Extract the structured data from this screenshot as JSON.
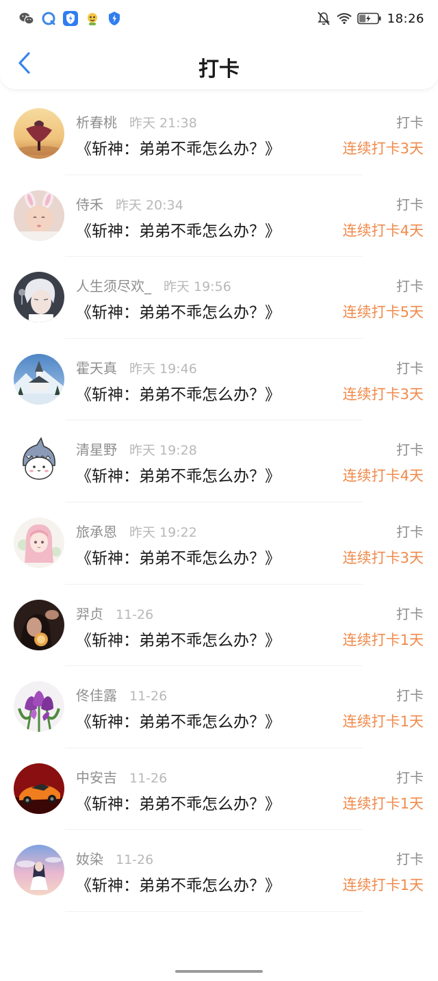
{
  "status_bar": {
    "time": "18:26",
    "left_icons": [
      "wechat-icon",
      "qq-icon",
      "security-shield-icon",
      "mascot-icon",
      "shield-small-icon"
    ],
    "right_icons": [
      "bell-muted-icon",
      "wifi-icon",
      "battery-icon"
    ],
    "battery_level": 0.35
  },
  "header": {
    "title": "打卡",
    "back_icon": "chevron-left-icon",
    "accent_color": "#3a86e8"
  },
  "colors": {
    "streak": "#f08a4b",
    "muted_text": "#8e8e8e",
    "time_text": "#b8b8b8"
  },
  "checkins": [
    {
      "name": "析春桃",
      "time": "昨天 21:38",
      "book": "《斩神：弟弟不乖怎么办？》",
      "action": "打卡",
      "streak": "连续打卡3天",
      "avatar": "sunset-dancer-avatar"
    },
    {
      "name": "侍禾",
      "time": "昨天 20:34",
      "book": "《斩神：弟弟不乖怎么办？》",
      "action": "打卡",
      "streak": "连续打卡4天",
      "avatar": "baby-bunny-ears-avatar"
    },
    {
      "name": "人生须尽欢_",
      "time": "昨天 19:56",
      "book": "《斩神：弟弟不乖怎么办？》",
      "action": "打卡",
      "streak": "连续打卡5天",
      "avatar": "silver-hair-singer-avatar"
    },
    {
      "name": "霍天真",
      "time": "昨天 19:46",
      "book": "《斩神：弟弟不乖怎么办？》",
      "action": "打卡",
      "streak": "连续打卡3天",
      "avatar": "snowy-church-avatar"
    },
    {
      "name": "清星野",
      "time": "昨天 19:28",
      "book": "《斩神：弟弟不乖怎么办？》",
      "action": "打卡",
      "streak": "连续打卡4天",
      "avatar": "shark-hoodie-cartoon-avatar"
    },
    {
      "name": "旅承恩",
      "time": "昨天 19:22",
      "book": "《斩神：弟弟不乖怎么办？》",
      "action": "打卡",
      "streak": "连续打卡3天",
      "avatar": "pink-anime-girl-avatar"
    },
    {
      "name": "羿贞",
      "time": "11-26",
      "book": "《斩神：弟弟不乖怎么办？》",
      "action": "打卡",
      "streak": "连续打卡1天",
      "avatar": "dark-portrait-avatar"
    },
    {
      "name": "佟佳露",
      "time": "11-26",
      "book": "《斩神：弟弟不乖怎么办？》",
      "action": "打卡",
      "streak": "连续打卡1天",
      "avatar": "purple-tulips-avatar"
    },
    {
      "name": "中安吉",
      "time": "11-26",
      "book": "《斩神：弟弟不乖怎么办？》",
      "action": "打卡",
      "streak": "连续打卡1天",
      "avatar": "orange-sports-car-avatar"
    },
    {
      "name": "奻染",
      "time": "11-26",
      "book": "《斩神：弟弟不乖怎么办？》",
      "action": "打卡",
      "streak": "连续打卡1天",
      "avatar": "sky-anime-girl-avatar"
    }
  ]
}
